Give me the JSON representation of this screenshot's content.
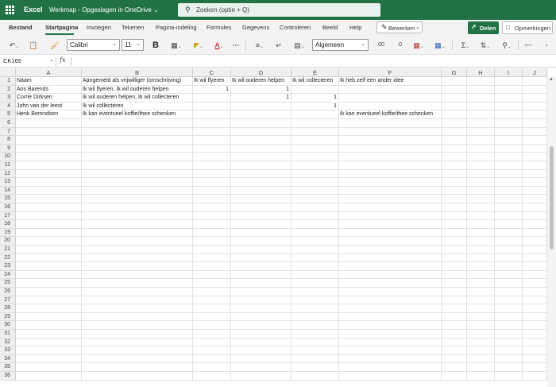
{
  "titlebar": {
    "app": "Excel",
    "document": "Werkmap - Opgeslagen in OneDrive ⌄",
    "search_placeholder": "Zoeken (optie + Q)"
  },
  "menu": {
    "tabs": [
      "Bestand",
      "Startpagina",
      "Invoegen",
      "Tekenen",
      "Pagina-indeling",
      "Formules",
      "Gegevens",
      "Controleren",
      "Beeld",
      "Help"
    ],
    "active_tab": "Startpagina",
    "edit_label": "Bewerken",
    "share_label": "Delen",
    "comments_label": "Opmerkingen"
  },
  "ribbon": {
    "font_name": "Calibri",
    "font_size": "11",
    "number_format": "Algemeen"
  },
  "formula_bar": {
    "name_box": "CK165",
    "fx": "fx",
    "content": ""
  },
  "sheet": {
    "columns": [
      "A",
      "B",
      "C",
      "D",
      "E",
      "F",
      "G",
      "H",
      "I",
      "J"
    ],
    "row_numbers": [
      "1",
      "2",
      "3",
      "4",
      "5",
      "6",
      "7",
      "8",
      "9",
      "10",
      "11",
      "12",
      "13",
      "14",
      "15",
      "16",
      "17",
      "18",
      "19",
      "20",
      "21",
      "22",
      "23",
      "24",
      "25",
      "26",
      "27",
      "28",
      "29",
      "30",
      "31",
      "32",
      "33",
      "34",
      "35",
      "36"
    ],
    "rows": [
      [
        "Naam",
        "Aangemeld als vrijwilliger (omschrijving)",
        "Ik wil flyeren",
        "Ik wil ouderen helpen",
        "Ik wil collecteren",
        "Ik heb zelf een ander idee"
      ],
      [
        "Ans Barends",
        "Ik wil flyeren, Ik wil ouderen helpen",
        "1",
        "1",
        "",
        ""
      ],
      [
        "Corrie Dirksen",
        "Ik wil ouderen helpen, Ik wil collecteren",
        "",
        "1",
        "1",
        ""
      ],
      [
        "John van der leest",
        "Ik wil collecteren",
        "",
        "",
        "1",
        ""
      ],
      [
        "Henk Berendsen",
        "Ik kan eventueel koffie/thee schenken",
        "",
        "",
        "",
        "Ik kan eventueel koffie/thee schenken"
      ]
    ]
  }
}
